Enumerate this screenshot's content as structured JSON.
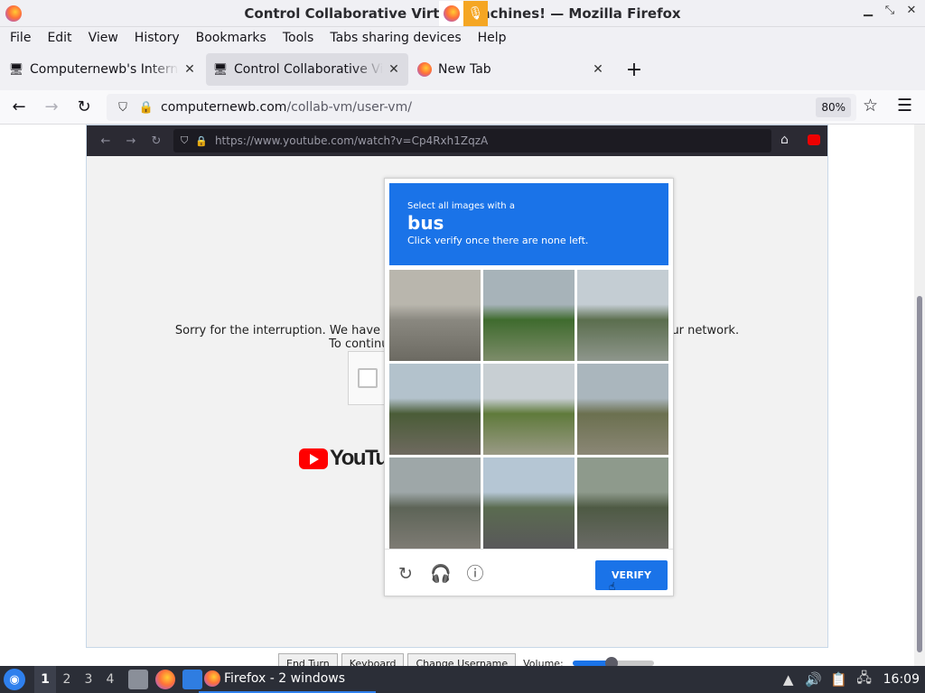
{
  "window": {
    "title": "Control Collaborative Virtual Machines! — Mozilla Firefox"
  },
  "menubar": [
    "File",
    "Edit",
    "View",
    "History",
    "Bookmarks",
    "Tools",
    "Tabs sharing devices",
    "Help"
  ],
  "tabs": [
    {
      "label": "Computernewb's Internet",
      "active": false
    },
    {
      "label": "Control Collaborative Virtual Machines!",
      "active": true
    },
    {
      "label": "New Tab",
      "active": false
    }
  ],
  "navbar": {
    "url_host": "computernewb.com",
    "url_path": "/collab-vm/user-vm/",
    "zoom": "80%"
  },
  "vm": {
    "url": "https://www.youtube.com/watch?v=Cp4Rxh1ZqzA",
    "sorry_line1": "Sorry for the interruption. We have b",
    "sorry_line1_end": "ur network.",
    "sorry_line2": "To continue with your Yo",
    "yt_word": "YouTube"
  },
  "captcha": {
    "line1": "Select all images with a",
    "target": "bus",
    "line3": "Click verify once there are none left.",
    "verify_label": "VERIFY",
    "tiles": [
      {
        "name": "tile-street-overpass",
        "colors": [
          "#b9b6ad",
          "#8a8880",
          "#6c6a62"
        ]
      },
      {
        "name": "tile-trees-building",
        "colors": [
          "#a7b3b9",
          "#3f6b2e",
          "#7d8c6a"
        ]
      },
      {
        "name": "tile-palm-sky",
        "colors": [
          "#c4cdd3",
          "#5b6e4e",
          "#8e968c"
        ]
      },
      {
        "name": "tile-road-trees",
        "colors": [
          "#b3c2cc",
          "#4a5c37",
          "#6f6a60"
        ]
      },
      {
        "name": "tile-palm-tree",
        "colors": [
          "#c8cfd3",
          "#5f7a3b",
          "#9a9a86"
        ]
      },
      {
        "name": "tile-traffic-lights",
        "colors": [
          "#aab6bd",
          "#6b704f",
          "#8b8776"
        ]
      },
      {
        "name": "tile-street-crossing",
        "colors": [
          "#9ea7a8",
          "#5d6457",
          "#7e7b74"
        ]
      },
      {
        "name": "tile-intersection-cars",
        "colors": [
          "#b5c6d4",
          "#5a6b50",
          "#59585a"
        ]
      },
      {
        "name": "tile-bus",
        "colors": [
          "#8e9a8c",
          "#4e5a44",
          "#6a6a66"
        ]
      }
    ]
  },
  "vm_controls": {
    "end_turn": "End Turn",
    "keyboard": "Keyboard",
    "change_username": "Change Username",
    "volume_label": "Volume:",
    "volume_level": 0.48
  },
  "taskbar": {
    "workspaces": [
      "1",
      "2",
      "3",
      "4"
    ],
    "active_workspace": "1",
    "window_label": "Firefox - 2 windows",
    "clock": "16:09"
  }
}
